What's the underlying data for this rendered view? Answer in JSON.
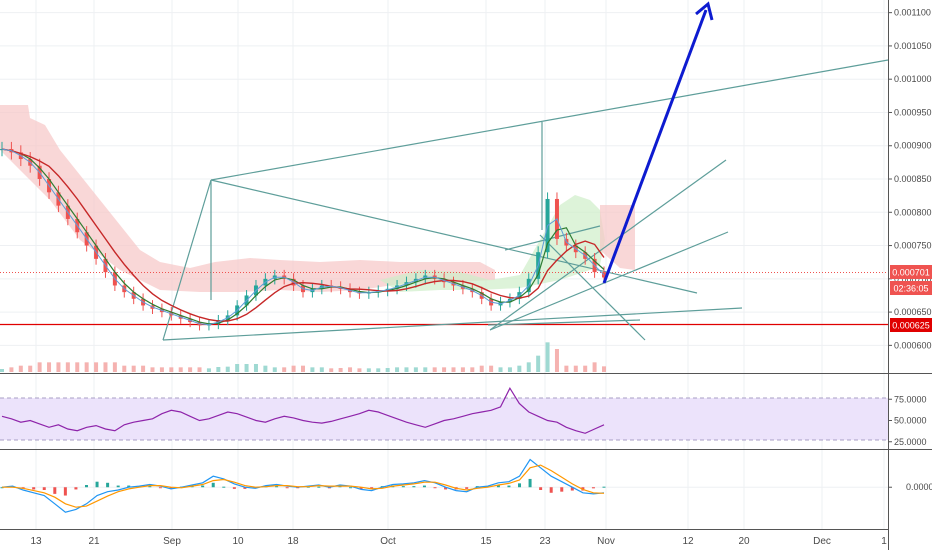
{
  "chart_data": {
    "type": "candlestick",
    "x_axis": {
      "tick_labels": [
        "13",
        "21",
        "Sep",
        "10",
        "18",
        "Oct",
        "15",
        "23",
        "Nov",
        "12",
        "20",
        "Dec",
        "1"
      ]
    },
    "price_panel": {
      "y_ticks": [
        "0.001100",
        "0.001050",
        "0.001000",
        "0.000950",
        "0.000900",
        "0.000850",
        "0.000800",
        "0.000750",
        "0.000700",
        "0.000650",
        "0.000600"
      ],
      "ylim": [
        0.000575,
        0.00111
      ],
      "current_price": "0.000701",
      "countdown": "02:36:05",
      "support_level": "0.000625",
      "colors": {
        "current": "#ef5350",
        "support": "#e00000",
        "projection": "#0d1bd0",
        "trendline": "#5e9e9a"
      },
      "close_series": [
        0.000895,
        0.00089,
        0.00088,
        0.00087,
        0.00085,
        0.00083,
        0.00081,
        0.00079,
        0.00077,
        0.00075,
        0.00073,
        0.00071,
        0.00069,
        0.00068,
        0.00067,
        0.00066,
        0.000655,
        0.00065,
        0.000645,
        0.00064,
        0.000635,
        0.00063,
        0.000632,
        0.000638,
        0.000645,
        0.00066,
        0.000675,
        0.00069,
        0.0007,
        0.000705,
        0.0007,
        0.00069,
        0.00068,
        0.000685,
        0.00069,
        0.000688,
        0.000685,
        0.00068,
        0.000678,
        0.00068,
        0.000682,
        0.000685,
        0.00069,
        0.000695,
        0.0007,
        0.000705,
        0.0007,
        0.000695,
        0.00069,
        0.000685,
        0.00068,
        0.00067,
        0.00066,
        0.000665,
        0.00067,
        0.00068,
        0.0007,
        0.00074,
        0.00082,
        0.00076,
        0.00075,
        0.00074,
        0.00073,
        0.00071,
        0.000702
      ]
    },
    "rsi_panel": {
      "y_ticks": [
        "75.0000",
        "50.0000",
        "25.0000"
      ],
      "ylim": [
        20,
        100
      ],
      "band": [
        30,
        70
      ],
      "values": [
        55,
        52,
        48,
        50,
        46,
        42,
        45,
        40,
        38,
        42,
        44,
        40,
        38,
        45,
        48,
        50,
        52,
        58,
        62,
        60,
        55,
        50,
        52,
        56,
        60,
        58,
        54,
        50,
        48,
        52,
        55,
        53,
        50,
        48,
        47,
        49,
        52,
        55,
        58,
        62,
        60,
        56,
        52,
        48,
        45,
        42,
        46,
        50,
        52,
        55,
        58,
        60,
        62,
        66,
        88,
        70,
        60,
        55,
        50,
        48,
        42,
        38,
        35,
        40,
        45
      ]
    },
    "macd_panel": {
      "y_ticks": [
        "0.0000"
      ],
      "ylim": [
        -7e-05,
        6e-05
      ],
      "macd": [
        0.0,
        2e-06,
        -5e-06,
        -1e-05,
        -1.5e-05,
        -3e-05,
        -4.5e-05,
        -4e-05,
        -3e-05,
        -1.5e-05,
        -8e-06,
        -5e-06,
        0.0,
        2e-06,
        5e-06,
        2e-06,
        -3e-06,
        0.0,
        4e-06,
        8e-06,
        2e-05,
        1.5e-05,
        6e-06,
        0.0,
        -2e-06,
        3e-06,
        5e-06,
        2e-06,
        0.0,
        2e-06,
        4e-06,
        0.0,
        4e-06,
        2e-06,
        -4e-06,
        -6e-06,
        0.0,
        5e-06,
        6e-06,
        8e-06,
        1.2e-05,
        8e-06,
        0.0,
        -6e-06,
        -8e-06,
        0.0,
        2e-06,
        8e-06,
        1e-05,
        2e-05,
        5e-05,
        3.5e-05,
        2e-05,
        1e-05,
        0.0,
        -1e-05,
        -1.2e-05,
        -1e-05
      ],
      "signal": [
        0.0,
        0.0,
        -2e-06,
        -6e-06,
        -1e-05,
        -1.8e-05,
        -3e-05,
        -3.6e-05,
        -3.4e-05,
        -2.5e-05,
        -1.6e-05,
        -8e-06,
        -3e-06,
        0.0,
        3e-06,
        3e-06,
        0.0,
        -1e-06,
        2e-06,
        5e-06,
        1.2e-05,
        1.4e-05,
        9e-06,
        3e-06,
        0.0,
        1e-06,
        3e-06,
        3e-06,
        1e-06,
        1e-06,
        3e-06,
        2e-06,
        2e-06,
        2e-06,
        0.0,
        -3e-06,
        -2e-06,
        2e-06,
        4e-06,
        6e-06,
        9e-06,
        9e-06,
        4e-06,
        -2e-06,
        -5e-06,
        -2e-06,
        0.0,
        4e-06,
        7e-06,
        1.3e-05,
        3.5e-05,
        4e-05,
        3e-05,
        1.8e-05,
        6e-06,
        -4e-06,
        -1e-05,
        -1.1e-05
      ]
    },
    "annotations": {
      "projection_arrow": "blue upward arrow from 0.000701 toward 0.001100",
      "patterns": [
        "broadening wedge",
        "triangle",
        "converging trendlines"
      ]
    }
  }
}
